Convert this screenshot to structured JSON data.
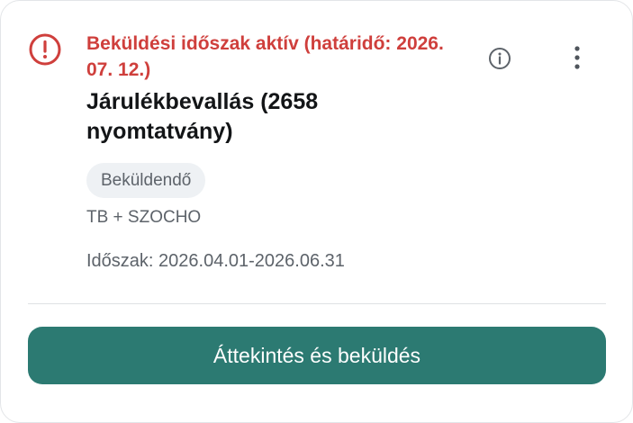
{
  "card": {
    "deadline_text": "Beküldési időszak aktív (határidő: 2026. 07. 12.)",
    "title": "Járulékbevallás (2658 nyomtatvány)",
    "status_badge": "Beküldendő",
    "subtitle": "TB + SZOCHO",
    "period": "Időszak: 2026.04.01-2026.06.31",
    "submit_label": "Áttekintés és beküldés"
  },
  "icons": {
    "alert": "alert-circle-icon",
    "info": "info-icon",
    "more": "more-vertical-icon"
  },
  "colors": {
    "alert": "#cf3f3c",
    "primary_button": "#2c7a72",
    "badge_bg": "#eef1f4",
    "muted_text": "#5d636a",
    "title_text": "#131517"
  }
}
